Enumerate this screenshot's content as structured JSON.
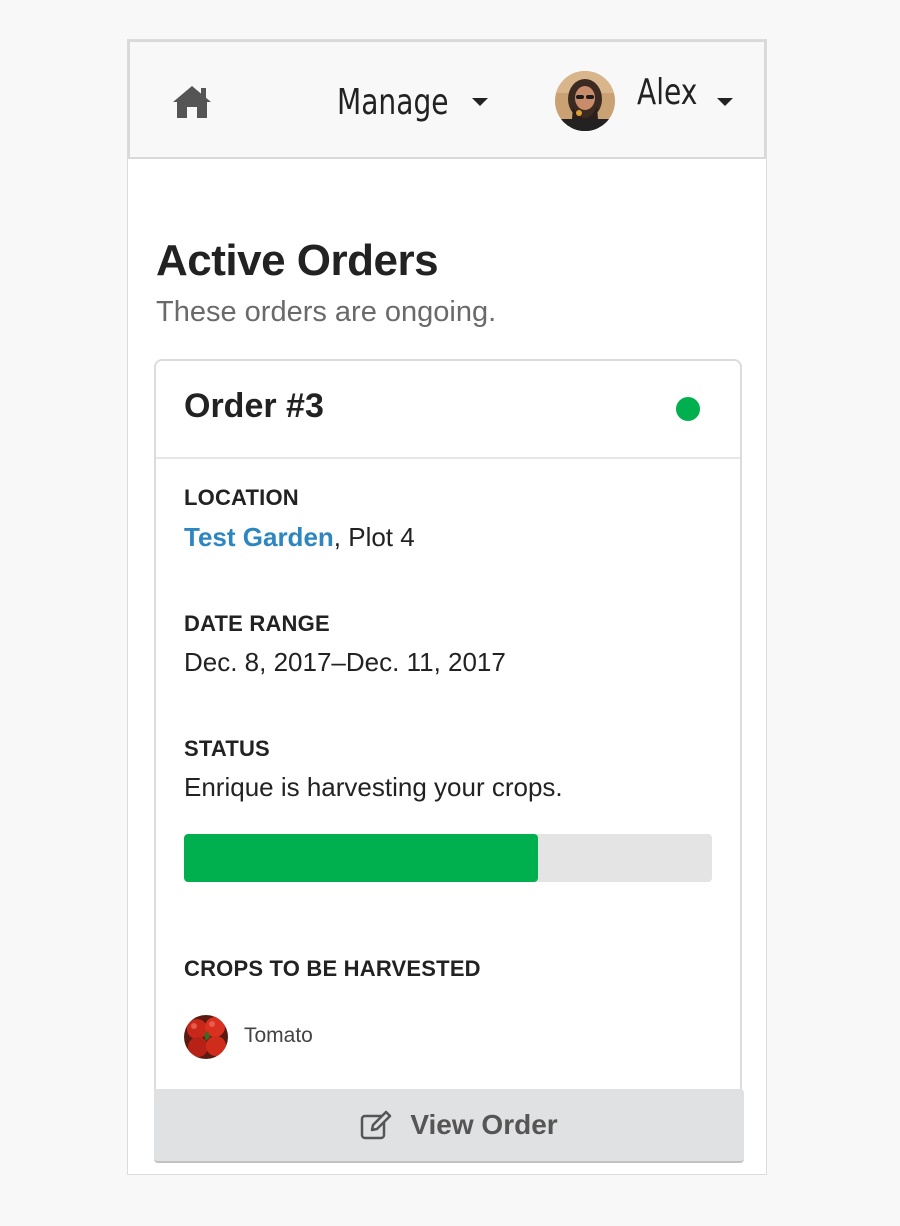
{
  "navbar": {
    "home_icon": "home-icon",
    "manage_label": "Manage",
    "user_name": "Alex"
  },
  "page": {
    "title": "Active Orders",
    "subtitle": "These orders are ongoing."
  },
  "order": {
    "title": "Order #3",
    "status_dot_color": "#00b04f",
    "location": {
      "label": "LOCATION",
      "garden": "Test Garden",
      "plot": ", Plot 4"
    },
    "date_range": {
      "label": "DATE RANGE",
      "value": "Dec. 8, 2017–Dec. 11, 2017"
    },
    "status": {
      "label": "STATUS",
      "value": "Enrique is harvesting your crops.",
      "progress_percent": 67
    },
    "crops": {
      "label": "CROPS TO BE HARVESTED",
      "items": [
        {
          "name": "Tomato",
          "icon": "tomato-thumbnail"
        }
      ]
    },
    "action": {
      "label": "View Order",
      "icon": "edit-icon"
    }
  },
  "colors": {
    "accent_green": "#00b04f",
    "link_blue": "#2e86c1"
  }
}
